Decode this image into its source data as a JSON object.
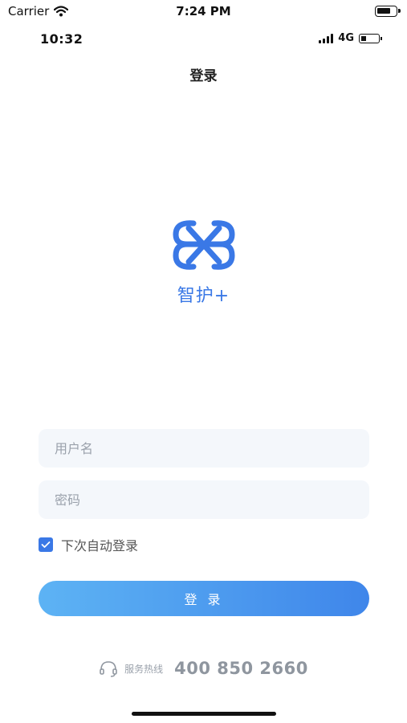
{
  "outer_status": {
    "carrier": "Carrier",
    "time": "7:24 PM"
  },
  "inner_status": {
    "time": "10:32",
    "network": "4G"
  },
  "nav": {
    "title": "登录"
  },
  "brand": {
    "name": "智护+"
  },
  "form": {
    "username_placeholder": "用户名",
    "password_placeholder": "密码",
    "remember_label": "下次自动登录",
    "remember_checked": true,
    "login_label": "登 录"
  },
  "support": {
    "label": "服务热线",
    "phone": "400 850 2660"
  },
  "colors": {
    "accent": "#3a78e6",
    "button_start": "#5db3f4",
    "button_end": "#3f86ea",
    "field_bg": "#f4f7fb"
  },
  "icons": [
    "wifi-icon",
    "battery-icon",
    "signal-icon",
    "brand-logo-icon",
    "check-icon",
    "headset-icon"
  ]
}
